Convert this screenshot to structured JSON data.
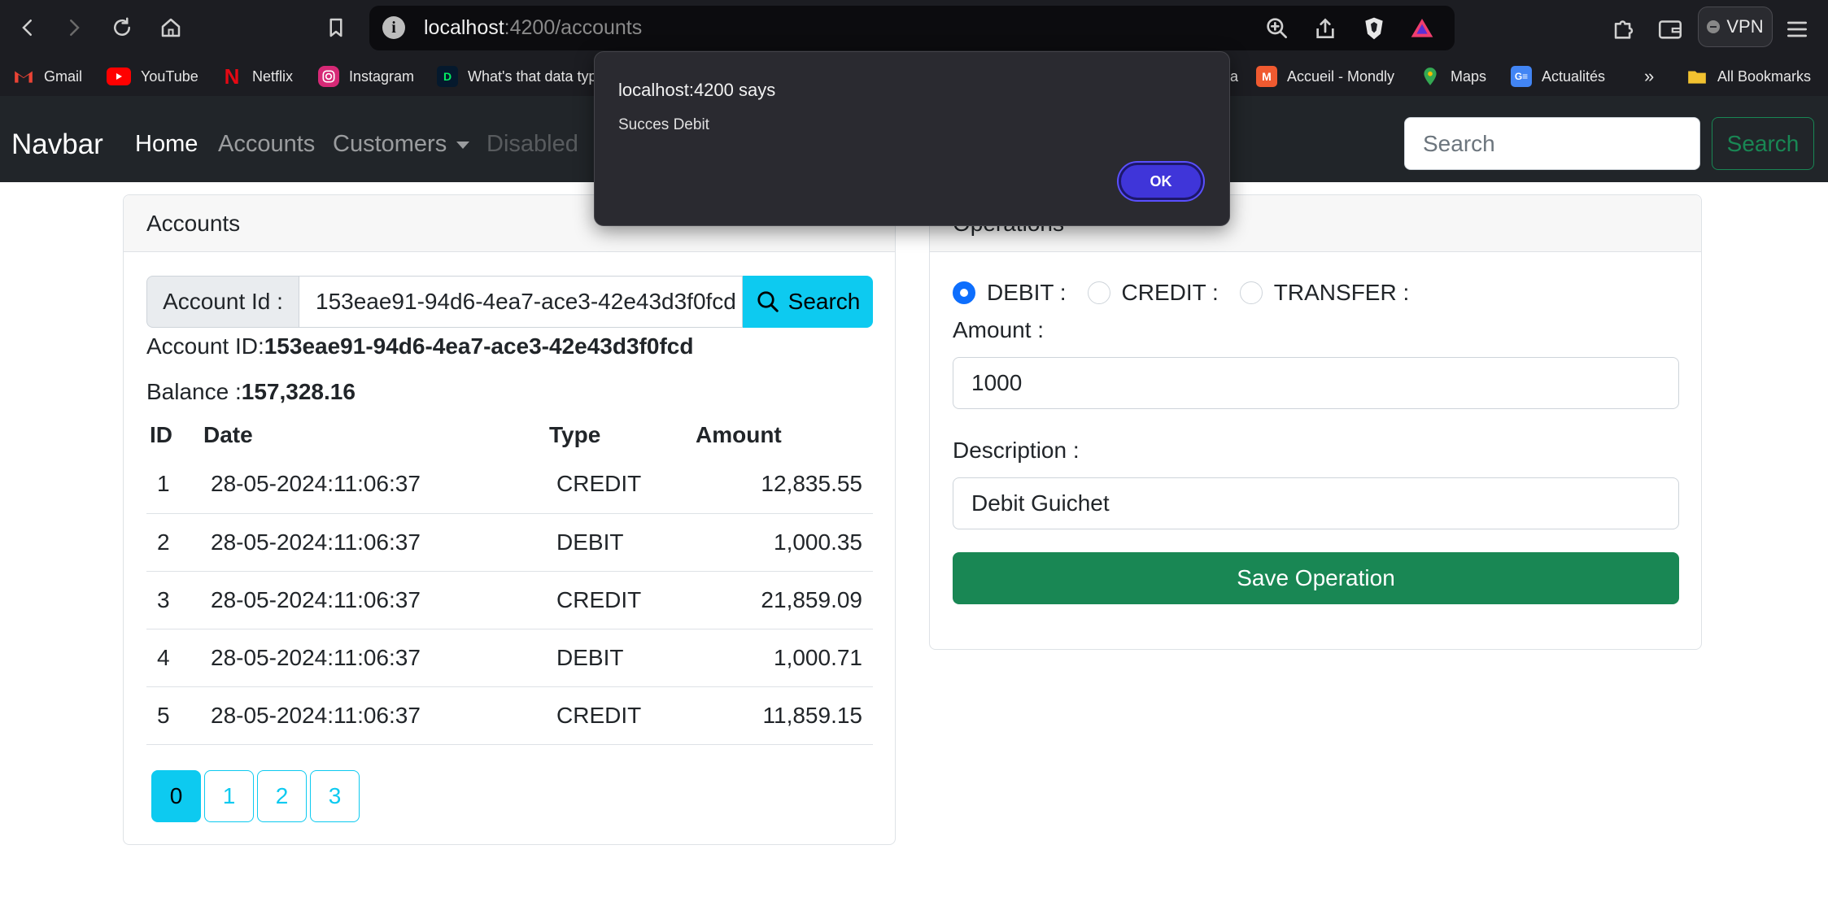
{
  "browser": {
    "url_host": "localhost",
    "url_path": ":4200/accounts",
    "vpn_label": "VPN",
    "bookmarks": [
      {
        "label": "Gmail",
        "icon": "gmail-icon",
        "color": "#ea4335"
      },
      {
        "label": "YouTube",
        "icon": "youtube-icon",
        "color": "#ff0000"
      },
      {
        "label": "Netflix",
        "icon": "netflix-icon",
        "color": "#e50914"
      },
      {
        "label": "Instagram",
        "icon": "instagram-icon",
        "color": "#d62976"
      },
      {
        "label": "What's that data typ",
        "icon": "datacamp-icon",
        "color": "#03ef62"
      },
      {
        "label": "a",
        "icon": "",
        "color": ""
      },
      {
        "label": "Accueil - Mondly",
        "icon": "mondly-icon",
        "color": "#f05a30"
      },
      {
        "label": "Maps",
        "icon": "maps-icon",
        "color": "#34a853"
      },
      {
        "label": "Actualités",
        "icon": "news-icon",
        "color": "#4285f4"
      }
    ],
    "overflow_label": "»",
    "all_bookmarks_label": "All Bookmarks"
  },
  "navbar": {
    "brand": "Navbar",
    "links": {
      "home": "Home",
      "accounts": "Accounts",
      "customers": "Customers",
      "disabled": "Disabled"
    },
    "search_placeholder": "Search",
    "search_button": "Search"
  },
  "accounts_card": {
    "header": "Accounts",
    "account_id_label": "Account Id :",
    "account_id_value": "153eae91-94d6-4ea7-ace3-42e43d3f0fcd",
    "search_button": "Search",
    "account_id_prefix": "Account ID:",
    "account_id_display": "153eae91-94d6-4ea7-ace3-42e43d3f0fcd",
    "balance_prefix": "Balance :",
    "balance": "157,328.16",
    "columns": {
      "id": "ID",
      "date": "Date",
      "type": "Type",
      "amount": "Amount"
    },
    "rows": [
      {
        "id": "1",
        "date": "28-05-2024:11:06:37",
        "type": "CREDIT",
        "amount": "12,835.55"
      },
      {
        "id": "2",
        "date": "28-05-2024:11:06:37",
        "type": "DEBIT",
        "amount": "1,000.35"
      },
      {
        "id": "3",
        "date": "28-05-2024:11:06:37",
        "type": "CREDIT",
        "amount": "21,859.09"
      },
      {
        "id": "4",
        "date": "28-05-2024:11:06:37",
        "type": "DEBIT",
        "amount": "1,000.71"
      },
      {
        "id": "5",
        "date": "28-05-2024:11:06:37",
        "type": "CREDIT",
        "amount": "11,859.15"
      }
    ],
    "pages": [
      "0",
      "1",
      "2",
      "3"
    ],
    "current_page": "0"
  },
  "operations_card": {
    "header": "Operations",
    "radio_debit": "DEBIT :",
    "radio_credit": "CREDIT :",
    "radio_transfer": "TRANSFER :",
    "selected": "DEBIT",
    "amount_label": "Amount :",
    "amount_value": "1000",
    "description_label": "Description :",
    "description_value": "Debit Guichet",
    "save_button": "Save Operation"
  },
  "dialog": {
    "title": "localhost:4200 says",
    "message": "Succes Debit",
    "ok_button": "OK"
  },
  "colors": {
    "primary_info": "#0dcaf0",
    "success": "#198754",
    "radio_checked": "#0d6efd",
    "dialog_ok": "#3f35d9"
  }
}
